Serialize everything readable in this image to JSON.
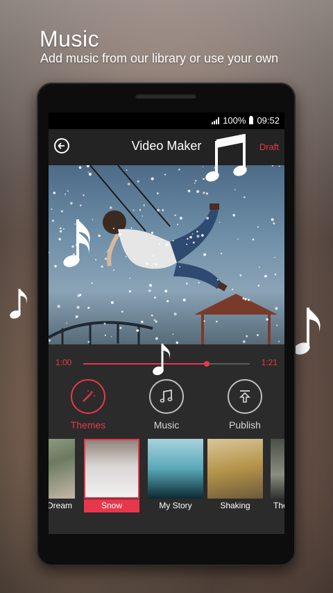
{
  "header": {
    "title": "Music",
    "subtitle": "Add music from our library or use your own"
  },
  "status_bar": {
    "battery": "100%",
    "time": "09:52"
  },
  "app_bar": {
    "title": "Video Maker",
    "draft_label": "Draft"
  },
  "player": {
    "current_time": "1:00",
    "total_time": "1:21",
    "progress": 0.74
  },
  "actions": [
    {
      "label": "Themes",
      "icon": "magic-wand-icon",
      "active": true
    },
    {
      "label": "Music",
      "icon": "music-note-icon",
      "active": false
    },
    {
      "label": "Publish",
      "icon": "upload-icon",
      "active": false
    }
  ],
  "themes": [
    {
      "label": "Dream",
      "shown": "Dream"
    },
    {
      "label": "Snow",
      "selected": true
    },
    {
      "label": "My Story"
    },
    {
      "label": "Shaking"
    },
    {
      "label": "The"
    }
  ],
  "colors": {
    "accent": "#e8374b",
    "screen_bg": "#2b2b2b"
  }
}
